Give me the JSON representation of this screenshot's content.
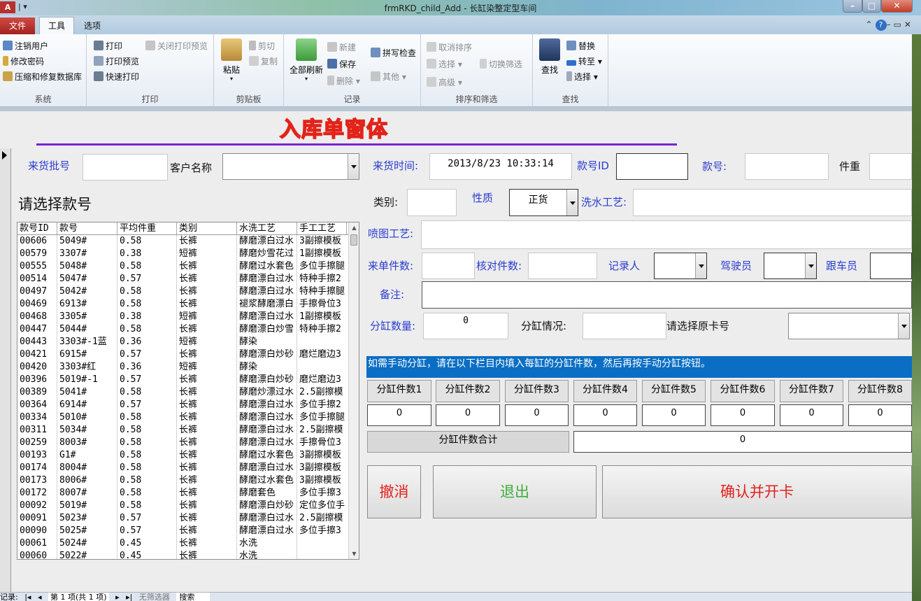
{
  "window": {
    "title": "frmRKD_child_Add - 长缸染整定型车间",
    "app_icon": "A"
  },
  "tabs": {
    "file": "文件",
    "tools": "工具",
    "options": "选项"
  },
  "ribbon": {
    "system": {
      "title": "系统",
      "items": [
        "注销用户",
        "修改密码",
        "压缩和修复数据库"
      ]
    },
    "print": {
      "title": "打印",
      "items": [
        "打印",
        "打印预览",
        "快速打印",
        "关闭打印预览"
      ]
    },
    "clipboard": {
      "title": "剪贴板",
      "paste": "粘贴",
      "cut": "剪切",
      "copy": "复制"
    },
    "records": {
      "title": "记录",
      "refresh_all": "全部刷新",
      "new": "新建",
      "save": "保存",
      "delete": "删除",
      "spelling": "拼写检查",
      "other": "其他"
    },
    "sort_filter": {
      "title": "排序和筛选",
      "clear_sort": "取消排序",
      "selection": "选择",
      "advanced": "高级",
      "toggle_filter": "切换筛选"
    },
    "find": {
      "title": "查找",
      "find": "查找",
      "replace": "替换",
      "goto": "转至",
      "select": "选择"
    }
  },
  "form": {
    "title": "入库单窗体",
    "fields": {
      "batch_no": {
        "label": "来货批号",
        "value": ""
      },
      "customer": {
        "label": "客户名称",
        "value": ""
      },
      "arrival_time": {
        "label": "来货时间:",
        "value": "2013/8/23 10:33:14"
      },
      "style_id": {
        "label": "款号ID",
        "value": ""
      },
      "style_no": {
        "label": "款号:",
        "value": ""
      },
      "piece_weight": {
        "label": "件重",
        "value": ""
      },
      "category": {
        "label": "类别:",
        "value": ""
      },
      "nature": {
        "label": "性质",
        "value": "正货"
      },
      "wash_process": {
        "label": "洗水工艺:",
        "value": ""
      },
      "spray_process": {
        "label": "喷图工艺:",
        "value": ""
      },
      "incoming_count": {
        "label": "来单件数:",
        "value": ""
      },
      "checked_count": {
        "label": "核对件数:",
        "value": ""
      },
      "recorder": {
        "label": "记录人",
        "value": ""
      },
      "driver": {
        "label": "驾驶员",
        "value": ""
      },
      "escort": {
        "label": "跟车员",
        "value": ""
      },
      "remark": {
        "label": "备注:",
        "value": ""
      },
      "split_qty": {
        "label": "分缸数量:",
        "value": "0"
      },
      "split_status": {
        "label": "分缸情况:",
        "value": ""
      },
      "original_card": {
        "label": "请选择原卡号",
        "value": ""
      }
    },
    "list": {
      "title": "请选择款号",
      "columns": [
        "款号ID",
        "款号",
        "平均件重",
        "类别",
        "水洗工艺",
        "手工工艺"
      ],
      "rows": [
        [
          "00606",
          "5049#",
          "0.58",
          "长裤",
          "酵磨漂白过水",
          "3副擦模板"
        ],
        [
          "00579",
          "3307#",
          "0.38",
          "短裤",
          "酵磨炒雪花过",
          "1副擦模板"
        ],
        [
          "00555",
          "5048#",
          "0.58",
          "长裤",
          "酵磨过水套色",
          "多位手擦腿"
        ],
        [
          "00514",
          "5047#",
          "0.57",
          "长裤",
          "酵磨漂白过水",
          "特种手擦2"
        ],
        [
          "00497",
          "5042#",
          "0.58",
          "长裤",
          "酵磨漂白过水",
          "特种手擦腿"
        ],
        [
          "00469",
          "6913#",
          "0.58",
          "长裤",
          "褪浆酵磨漂白",
          "手擦骨位3"
        ],
        [
          "00468",
          "3305#",
          "0.38",
          "短裤",
          "酵磨漂白过水",
          "1副擦模板"
        ],
        [
          "00447",
          "5044#",
          "0.58",
          "长裤",
          "酵磨漂白炒雪",
          "特种手擦2"
        ],
        [
          "00443",
          "3303#-1蓝",
          "0.36",
          "短裤",
          "酵染",
          ""
        ],
        [
          "00421",
          "6915#",
          "0.57",
          "长裤",
          "酵磨漂白炒砂",
          "磨烂磨边3"
        ],
        [
          "00420",
          "3303#红",
          "0.36",
          "短裤",
          "酵染",
          ""
        ],
        [
          "00396",
          "5019#-1",
          "0.57",
          "长裤",
          "酵磨漂白炒砂",
          "磨烂磨边3"
        ],
        [
          "00389",
          "5041#",
          "0.58",
          "长裤",
          "酵磨炒漂过水",
          "2.5副擦模"
        ],
        [
          "00364",
          "6914#",
          "0.57",
          "长裤",
          "酵磨漂白过水",
          "多位手擦2"
        ],
        [
          "00334",
          "5010#",
          "0.58",
          "长裤",
          "酵磨漂白过水",
          "多位手擦腿"
        ],
        [
          "00311",
          "5034#",
          "0.58",
          "长裤",
          "酵磨漂白过水",
          "2.5副擦模"
        ],
        [
          "00259",
          "8003#",
          "0.58",
          "长裤",
          "酵磨漂白过水",
          "手擦骨位3"
        ],
        [
          "00193",
          "G1#",
          "0.58",
          "长裤",
          "酵磨过水套色",
          "3副擦模板"
        ],
        [
          "00174",
          "8004#",
          "0.58",
          "长裤",
          "酵磨漂白过水",
          "3副擦模板"
        ],
        [
          "00173",
          "8006#",
          "0.58",
          "长裤",
          "酵磨过水套色",
          "3副擦模板"
        ],
        [
          "00172",
          "8007#",
          "0.58",
          "长裤",
          "酵磨套色",
          "多位手擦3"
        ],
        [
          "00092",
          "5019#",
          "0.58",
          "长裤",
          "酵磨漂白炒砂",
          "定位多位手"
        ],
        [
          "00091",
          "5023#",
          "0.57",
          "长裤",
          "酵磨漂白过水",
          "2.5副擦模"
        ],
        [
          "00090",
          "5025#",
          "0.57",
          "长裤",
          "酵磨漂白过水",
          "多位手擦3"
        ],
        [
          "00061",
          "5024#",
          "0.45",
          "长裤",
          "水洗",
          ""
        ],
        [
          "00060",
          "5022#",
          "0.45",
          "长裤",
          "水洗",
          ""
        ]
      ]
    },
    "split": {
      "info": "如需手动分缸，请在以下栏目内填入每缸的分缸件数，然后再按手动分缸按钮。",
      "headers": [
        "分缸件数1",
        "分缸件数2",
        "分缸件数3",
        "分缸件数4",
        "分缸件数5",
        "分缸件数6",
        "分缸件数7",
        "分缸件数8"
      ],
      "values": [
        "0",
        "0",
        "0",
        "0",
        "0",
        "0",
        "0",
        "0"
      ],
      "sum_label": "分缸件数合计",
      "sum_value": "0"
    },
    "buttons": {
      "cancel": "撤消",
      "exit": "退出",
      "confirm": "确认并开卡"
    },
    "button_colors": {
      "cancel": "#e3221c",
      "exit": "#3fae3a",
      "confirm": "#e3221c"
    }
  },
  "statusbar": {
    "record_label": "记录:",
    "record_pos": "第 1 项(共 1 项)",
    "filter": "无筛选器",
    "search": "搜索"
  }
}
